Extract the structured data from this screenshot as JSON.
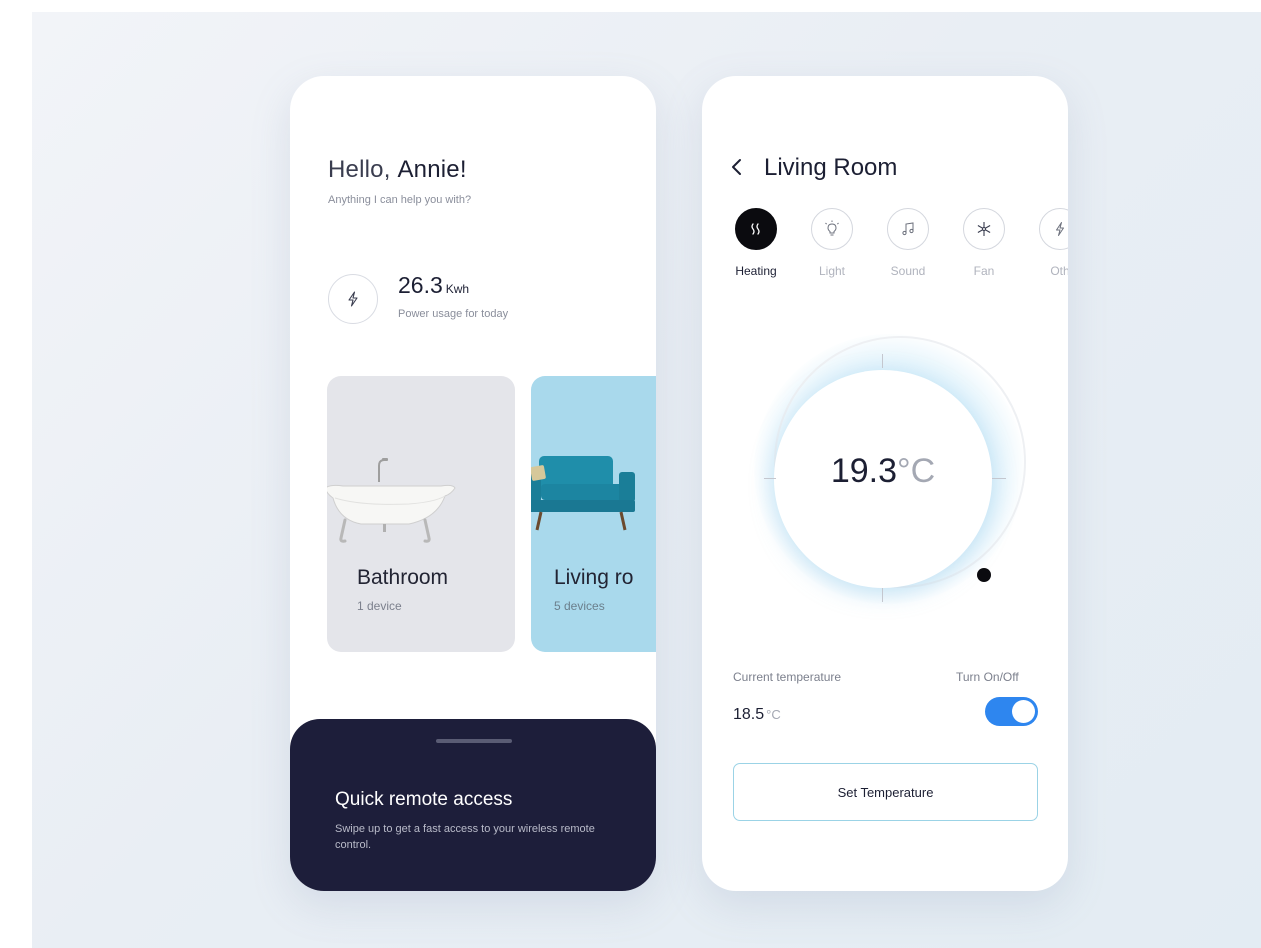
{
  "home": {
    "greeting_hello": "Hello,",
    "greeting_name": "Annie!",
    "subtitle": "Anything I can help you with?",
    "power": {
      "value": "26.3",
      "unit": "Kwh",
      "label": "Power usage for today"
    },
    "rooms": [
      {
        "name": "Bathroom",
        "devices": "1 device"
      },
      {
        "name": "Living ro",
        "devices": "5 devices"
      }
    ],
    "quick_access": {
      "title": "Quick remote access",
      "description": "Swipe up to get a fast access to your wireless remote control."
    }
  },
  "room": {
    "title": "Living Room",
    "tabs": [
      {
        "label": "Heating",
        "icon": "heating-icon",
        "active": true
      },
      {
        "label": "Light",
        "icon": "light-bulb-icon",
        "active": false
      },
      {
        "label": "Sound",
        "icon": "music-note-icon",
        "active": false
      },
      {
        "label": "Fan",
        "icon": "fan-icon",
        "active": false
      },
      {
        "label": "Oth",
        "icon": "lightning-icon",
        "active": false
      }
    ],
    "target_temp": "19.3",
    "target_unit": "°C",
    "current_label": "Current temperature",
    "current_temp": "18.5",
    "current_unit": "°C",
    "toggle_label": "Turn On/Off",
    "toggle_on": true,
    "set_button": "Set Temperature"
  },
  "colors": {
    "accent_blue": "#2e86ef",
    "navy": "#1d1e3a",
    "living_card": "#a9d9ec",
    "bathroom_card": "#e4e5ea"
  }
}
